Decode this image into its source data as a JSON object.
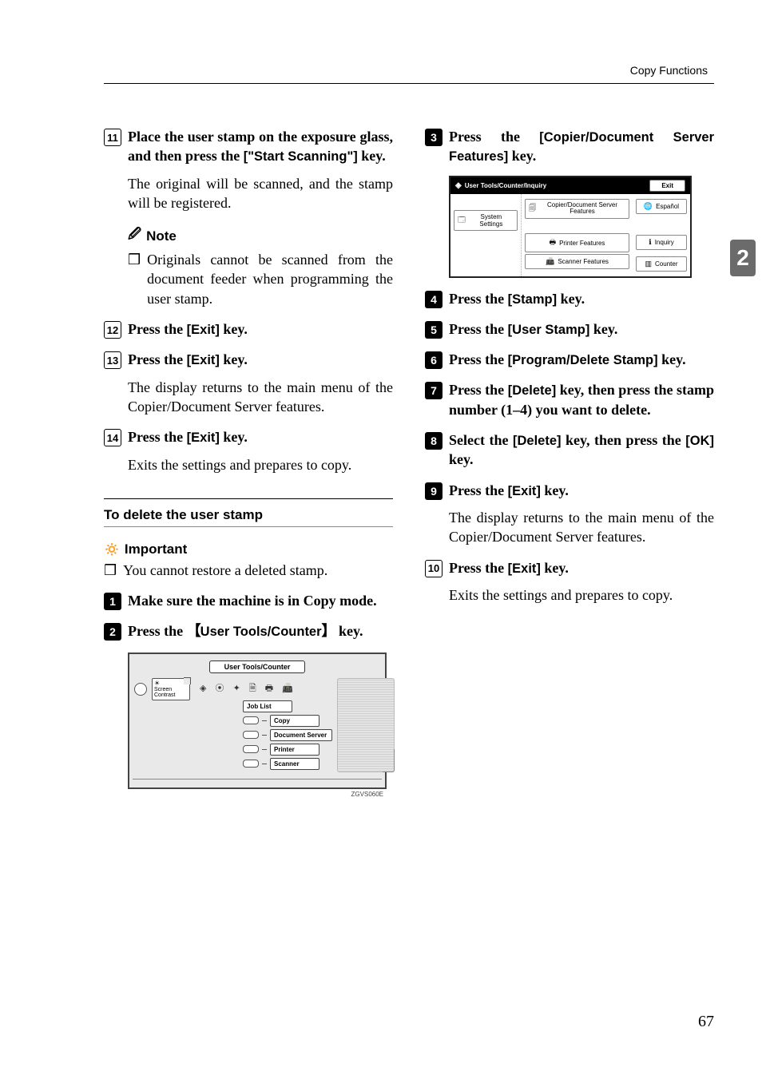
{
  "running_head": "Copy Functions",
  "side_tab": "2",
  "page_number": "67",
  "left": {
    "s11": {
      "text_a": "Place the user stamp on the exposure glass, and then press the ",
      "key": "[\"Start Scanning\"]",
      "text_b": " key."
    },
    "s11_desc": "The original will be scanned, and the stamp will be registered.",
    "note_label": "Note",
    "note_item": "Originals cannot be scanned from the document feeder when programming the user stamp.",
    "s12": {
      "text_a": "Press the ",
      "key": "[Exit]",
      "text_b": " key."
    },
    "s13": {
      "text_a": "Press the ",
      "key": "[Exit]",
      "text_b": " key."
    },
    "s13_desc": "The display returns to the main menu of the Copier/Document Server features.",
    "s14": {
      "text_a": "Press the ",
      "key": "[Exit]",
      "text_b": " key."
    },
    "s14_desc": "Exits the settings and prepares to copy.",
    "section_title": "To delete the user stamp",
    "important_label": "Important",
    "important_item": "You cannot restore a deleted stamp.",
    "s1": "Make sure the machine is in Copy mode.",
    "s2": {
      "text_a": "Press the ",
      "key": "User Tools/Counter",
      "text_b": " key."
    }
  },
  "panel": {
    "title": "User Tools/Counter",
    "screen_contrast_a": "Screen",
    "screen_contrast_b": "Contrast",
    "btn_joblist": "Job List",
    "btn_copy": "Copy",
    "btn_docserver": "Document Server",
    "btn_printer": "Printer",
    "btn_scanner": "Scanner",
    "code": "ZGVS060E"
  },
  "right": {
    "s3": {
      "text_a": "Press the ",
      "key": "[Copier/Document Server Features]",
      "text_b": " key."
    },
    "s4": {
      "text_a": "Press the ",
      "key": "[Stamp]",
      "text_b": " key."
    },
    "s5": {
      "text_a": "Press the ",
      "key": "[User Stamp]",
      "text_b": " key."
    },
    "s6": {
      "text_a": "Press the ",
      "key": "[Program/Delete Stamp]",
      "text_b": " key."
    },
    "s7": {
      "text_a": "Press the ",
      "key1": "[Delete]",
      "text_b": " key, then press the stamp number (1–4) you want to delete."
    },
    "s8": {
      "text_a": "Select the ",
      "key1": "[Delete]",
      "text_b": " key, then press the ",
      "key2": "[OK]",
      "text_c": " key."
    },
    "s9": {
      "text_a": "Press the ",
      "key": "[Exit]",
      "text_b": " key."
    },
    "s9_desc": "The display returns to the main menu of the Copier/Document Server features.",
    "s10": {
      "text_a": "Press the ",
      "key": "[Exit]",
      "text_b": " key."
    },
    "s10_desc": "Exits the settings and prepares to copy."
  },
  "screen": {
    "title": "User Tools/Counter/Inquiry",
    "exit": "Exit",
    "left_btn": "System Settings",
    "mid_btn1": "Copier/Document Server Features",
    "mid_btn2": "Printer Features",
    "mid_btn3": "Scanner Features",
    "right_btn1": "Español",
    "right_btn2": "Inquiry",
    "right_btn3": "Counter"
  }
}
